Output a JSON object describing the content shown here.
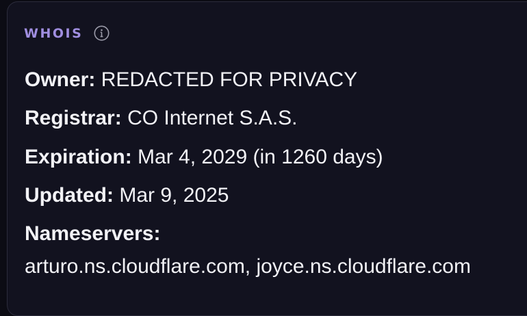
{
  "whois": {
    "title": "WHOIS",
    "icon": "info-icon",
    "accent_color": "#a08ee0",
    "fields": {
      "owner": {
        "label": "Owner:",
        "value": "REDACTED FOR PRIVACY"
      },
      "registrar": {
        "label": "Registrar:",
        "value": "CO Internet S.A.S."
      },
      "expiration": {
        "label": "Expiration:",
        "value": "Mar 4, 2029 (in 1260 days)"
      },
      "updated": {
        "label": "Updated:",
        "value": "Mar 9, 2025"
      },
      "nameservers": {
        "label": "Nameservers:",
        "value": "arturo.ns.cloudflare.com, joyce.ns.cloudflare.com"
      }
    }
  }
}
